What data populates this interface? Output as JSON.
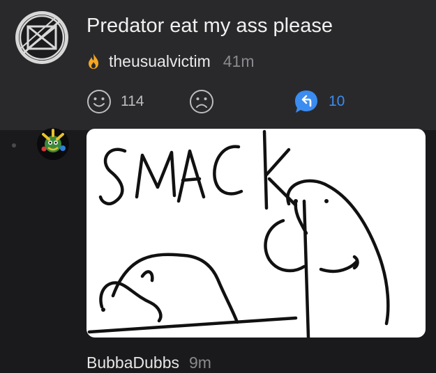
{
  "post": {
    "title": "Predator eat my ass please",
    "author": "theusualvictim",
    "time": "41m",
    "upvotes": "114",
    "replies": "10"
  },
  "comment": {
    "image_text": "SMACK",
    "user": "BubbaDubbs",
    "time": "9m"
  },
  "colors": {
    "post_background": "#29292c",
    "page_background": "#1a1a1c",
    "reply_accent": "#3b8cf0",
    "flame": "#f5a623"
  },
  "icons": [
    "crossed-circle-avatar",
    "flame-icon",
    "smiley-icon",
    "frown-icon",
    "reply-icon",
    "comment-avatar"
  ]
}
